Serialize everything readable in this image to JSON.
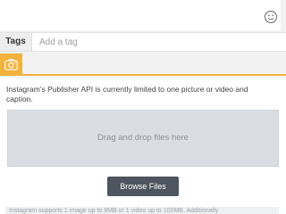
{
  "composer": {
    "emoji_icon": "smiley-face-icon"
  },
  "tags": {
    "label": "Tags",
    "placeholder": "Add a tag",
    "value": ""
  },
  "tabs": [
    {
      "icon": "instagram-camera-icon",
      "active": true
    }
  ],
  "colors": {
    "accent": "#f3b23c",
    "button": "#4d5660",
    "dropzone": "#dadde1"
  },
  "publisher": {
    "notice": "Instagram’s Publisher API is currently limited to one picture or video and caption.",
    "dropzone_text": "Drag and drop files here",
    "browse_label": "Browse Files",
    "limits_text": "Instagram supports 1 image up to 8MB or 1 video up to 100MB. Additionally"
  }
}
